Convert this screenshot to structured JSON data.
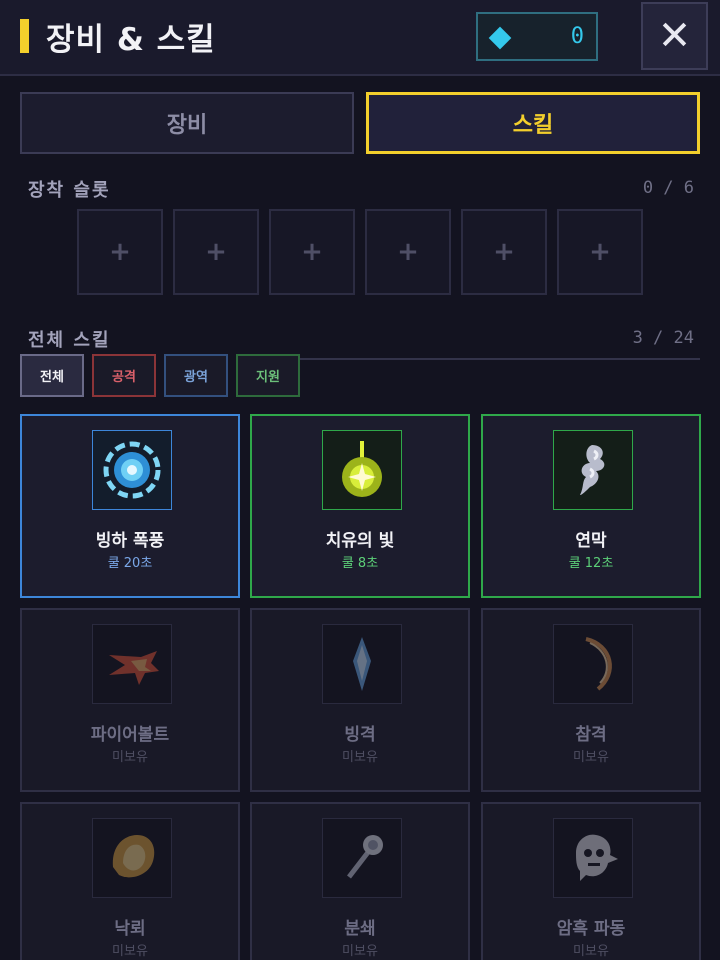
{
  "header": {
    "title": "장비 & 스킬",
    "currency": "0",
    "close_label": "✕"
  },
  "tabs": {
    "equipment": "장비",
    "skills": "스킬"
  },
  "slots": {
    "title": "장착 슬롯",
    "count": "0 / 6",
    "items": [
      "+",
      "+",
      "+",
      "+",
      "+",
      "+"
    ]
  },
  "skills": {
    "title": "전체 스킬",
    "count": "3 / 24",
    "filters": {
      "all": "전체",
      "attack": "공격",
      "aoe": "광역",
      "support": "지원"
    },
    "cards": [
      {
        "name": "빙하 폭풍",
        "sub": "쿨 20초",
        "icon": "ice-storm-icon"
      },
      {
        "name": "치유의 빛",
        "sub": "쿨 8초",
        "icon": "healing-light-icon"
      },
      {
        "name": "연막",
        "sub": "쿨 12초",
        "icon": "smoke-icon"
      },
      {
        "name": "파이어볼트",
        "sub": "미보유",
        "icon": "fire-bolt-icon"
      },
      {
        "name": "빙격",
        "sub": "미보유",
        "icon": "ice-shard-icon"
      },
      {
        "name": "참격",
        "sub": "미보유",
        "icon": "slash-icon"
      },
      {
        "name": "낙뢰",
        "sub": "미보유",
        "icon": "lightning-strike-icon"
      },
      {
        "name": "분쇄",
        "sub": "미보유",
        "icon": "crush-icon"
      },
      {
        "name": "암흑 파동",
        "sub": "미보유",
        "icon": "dark-wave-icon"
      }
    ]
  },
  "colors": {
    "accent": "#f3cf2c",
    "gem": "#34c9ec",
    "owned_blue": "#3d86d9",
    "owned_green": "#2fa84a"
  }
}
